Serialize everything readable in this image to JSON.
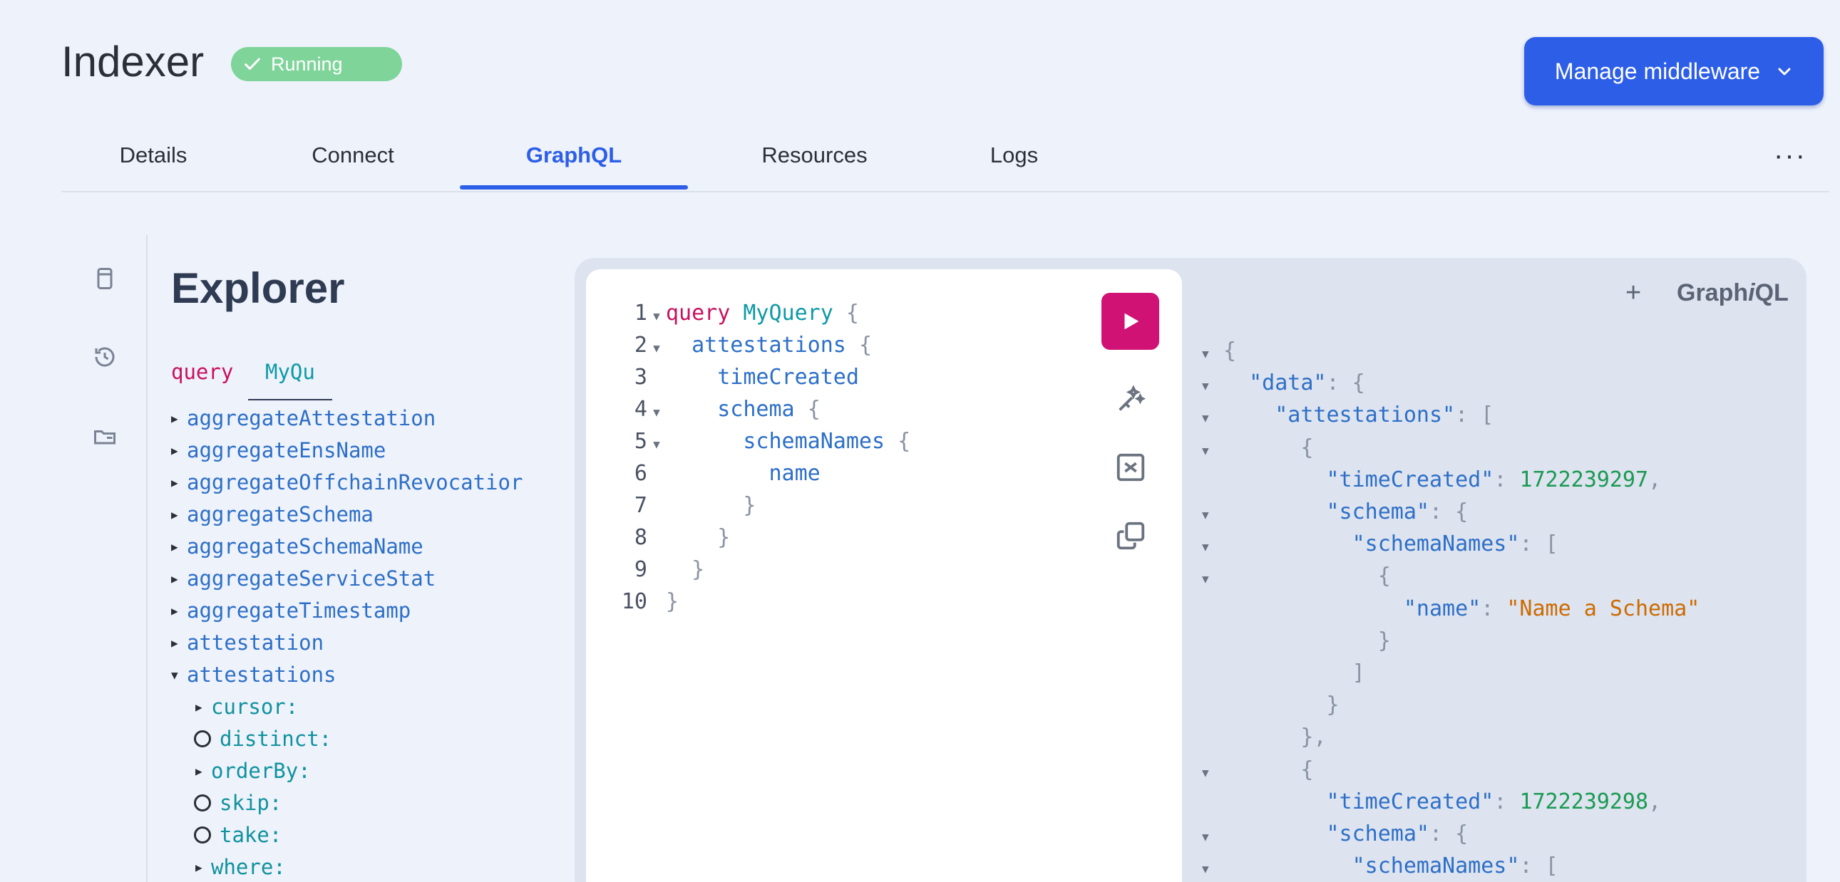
{
  "header": {
    "title": "Indexer",
    "status_badge": "Running",
    "manage_button": "Manage middleware"
  },
  "tabs": [
    {
      "label": "Details"
    },
    {
      "label": "Connect"
    },
    {
      "label": "GraphQL",
      "active": true
    },
    {
      "label": "Resources"
    },
    {
      "label": "Logs"
    }
  ],
  "more_menu": "···",
  "rail_icons": [
    "doc-icon",
    "history-icon",
    "folder-icon"
  ],
  "explorer": {
    "title": "Explorer",
    "query_keyword": "query",
    "query_name": "MyQuery",
    "fields": [
      {
        "label": "aggregateAttestation",
        "expanded": false
      },
      {
        "label": "aggregateEnsName",
        "expanded": false
      },
      {
        "label": "aggregateOffchainRevocatior",
        "expanded": false
      },
      {
        "label": "aggregateSchema",
        "expanded": false
      },
      {
        "label": "aggregateSchemaName",
        "expanded": false
      },
      {
        "label": "aggregateServiceStat",
        "expanded": false
      },
      {
        "label": "aggregateTimestamp",
        "expanded": false
      },
      {
        "label": "attestation",
        "expanded": false
      },
      {
        "label": "attestations",
        "expanded": true
      }
    ],
    "args": [
      {
        "label": "cursor:",
        "kind": "arrow"
      },
      {
        "label": "distinct:",
        "kind": "circle"
      },
      {
        "label": "orderBy:",
        "kind": "arrow"
      },
      {
        "label": "skip:",
        "kind": "circle"
      },
      {
        "label": "take:",
        "kind": "circle"
      },
      {
        "label": "where:",
        "kind": "arrow"
      }
    ]
  },
  "editor": {
    "lines": [
      {
        "n": "1",
        "text": "query MyQuery {"
      },
      {
        "n": "2",
        "text": "  attestations {"
      },
      {
        "n": "3",
        "text": "    timeCreated"
      },
      {
        "n": "4",
        "text": "    schema {"
      },
      {
        "n": "5",
        "text": "      schemaNames {"
      },
      {
        "n": "6",
        "text": "        name"
      },
      {
        "n": "7",
        "text": "      }"
      },
      {
        "n": "8",
        "text": "    }"
      },
      {
        "n": "9",
        "text": "  }"
      },
      {
        "n": "10",
        "text": "}"
      }
    ]
  },
  "graphiql_brand": {
    "pre": "Graph",
    "i": "i",
    "post": "QL"
  },
  "new_tab": "+",
  "result": {
    "lines": [
      "{",
      "  \"data\": {",
      "    \"attestations\": [",
      "      {",
      "        \"timeCreated\": 1722239297,",
      "        \"schema\": {",
      "          \"schemaNames\": [",
      "            {",
      "              \"name\": \"Name a Schema\"",
      "            }",
      "          ]",
      "        }",
      "      },",
      "      {",
      "        \"timeCreated\": 1722239298,",
      "        \"schema\": {",
      "          \"schemaNames\": ["
    ]
  },
  "colors": {
    "accent": "#2d5ee8",
    "running": "#7fd49a",
    "run_button": "#cf1273"
  }
}
